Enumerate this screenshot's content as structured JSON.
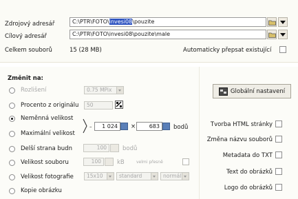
{
  "paths": {
    "source_label": "Zdrojový adresář",
    "source_before": "C:\\PTR\\FOTO\\",
    "source_selected": "invesi08",
    "source_after": "\\pouzite",
    "target_label": "Cílový adresář",
    "target_value": "C:\\PTR\\FOTO\\invesi08\\pouzite\\male",
    "total_label": "Celkem souborů",
    "total_value": "15 (28 MB)",
    "overwrite_label": "Automaticky přepsat existující"
  },
  "resize": {
    "heading": "Změnit na:",
    "options": [
      {
        "label": "Rozlišení",
        "selected": false,
        "disabled": true
      },
      {
        "label": "Procento z originálu",
        "selected": false,
        "disabled": false
      },
      {
        "label": "Neměnná velikost",
        "selected": true,
        "disabled": false
      },
      {
        "label": "Maximální velikost",
        "selected": false,
        "disabled": false
      },
      {
        "label": "Delší strana budn",
        "selected": false,
        "disabled": false
      },
      {
        "label": "Velikost souboru",
        "selected": false,
        "disabled": false
      },
      {
        "label": "Velikost fotografie",
        "selected": false,
        "disabled": false
      },
      {
        "label": "Kopie obrázku",
        "selected": false,
        "disabled": false
      }
    ],
    "resolution_value": "0.75 MPix",
    "percent_value": "50",
    "width_value": "1 024",
    "times": "×",
    "height_value": "683",
    "size_unit": "bodů",
    "long_side_value": "100",
    "long_side_unit": "bodů",
    "file_size_value": "100",
    "file_size_unit": "kB",
    "file_size_note": "velmi přesně",
    "photo_size_value": "15x10",
    "photo_standard_value": "standard",
    "photo_normal_value": "normál"
  },
  "side": {
    "global_settings_label": "Globální nastavení",
    "options": [
      {
        "label": "Tvorba HTML stránky",
        "checked": false
      },
      {
        "label": "Změna názvu souborů",
        "checked": false
      },
      {
        "label": "Metadata do TXT",
        "checked": false
      },
      {
        "label": "Text do obrázků",
        "checked": false
      },
      {
        "label": "Logo do obrázků",
        "checked": false
      }
    ]
  },
  "colors": {
    "selection": "#2c52c0",
    "spin_button": "#5a7fb8"
  }
}
